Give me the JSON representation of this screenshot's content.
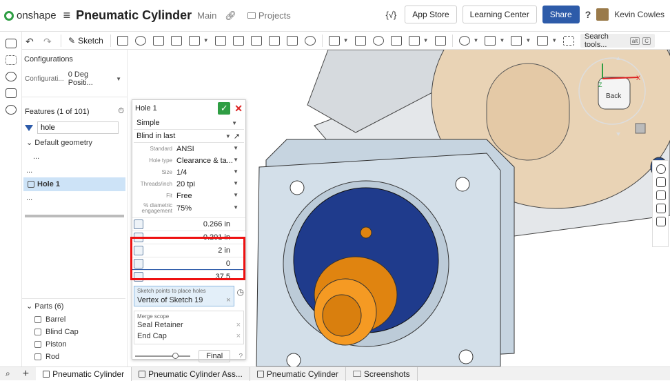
{
  "header": {
    "brand": "onshape",
    "title": "Pneumatic Cylinder",
    "branch": "Main",
    "projects": "Projects",
    "curly": "{√}",
    "app_store": "App Store",
    "learning_center": "Learning Center",
    "share": "Share",
    "help": "?",
    "user": "Kevin Cowles"
  },
  "toolbar": {
    "sketch": "Sketch",
    "search_tools": "Search tools...",
    "shortcut": [
      "alt",
      "C"
    ]
  },
  "config": {
    "heading": "Configurations",
    "label": "Configurati...",
    "value": "0 Deg Positi..."
  },
  "features": {
    "heading": "Features (1 of 101)",
    "filter": "hole",
    "default_geometry": "Default geometry",
    "ellipsis": "...",
    "selected": "Hole 1"
  },
  "parts": {
    "heading": "Parts (6)",
    "items": [
      "Barrel",
      "Blind Cap",
      "Piston",
      "Rod"
    ]
  },
  "hole_dialog": {
    "title": "Hole 1",
    "style": "Simple",
    "termination": "Blind in last",
    "params": [
      {
        "label": "Standard",
        "value": "ANSI"
      },
      {
        "label": "Hole type",
        "value": "Clearance & ta..."
      },
      {
        "label": "Size",
        "value": "1/4"
      },
      {
        "label": "Threads/inch",
        "value": "20 tpi"
      },
      {
        "label": "Fit",
        "value": "Free"
      },
      {
        "label": "% diametric engagement",
        "value": "75%"
      }
    ],
    "dims": [
      "0.266 in",
      "0.201 in",
      "2 in",
      "0",
      "37.5"
    ],
    "sketch_points_label": "Sketch points to place holes",
    "sketch_point": "Vertex of Sketch 19",
    "merge_label": "Merge scope",
    "merge_items": [
      "Seal Retainer",
      "End Cap"
    ],
    "final": "Final"
  },
  "viewcube": {
    "face": "Back",
    "axis_x": "X",
    "axis_z": "Z"
  },
  "tabs": [
    "Pneumatic Cylinder",
    "Pneumatic Cylinder Ass...",
    "Pneumatic Cylinder",
    "Screenshots"
  ]
}
